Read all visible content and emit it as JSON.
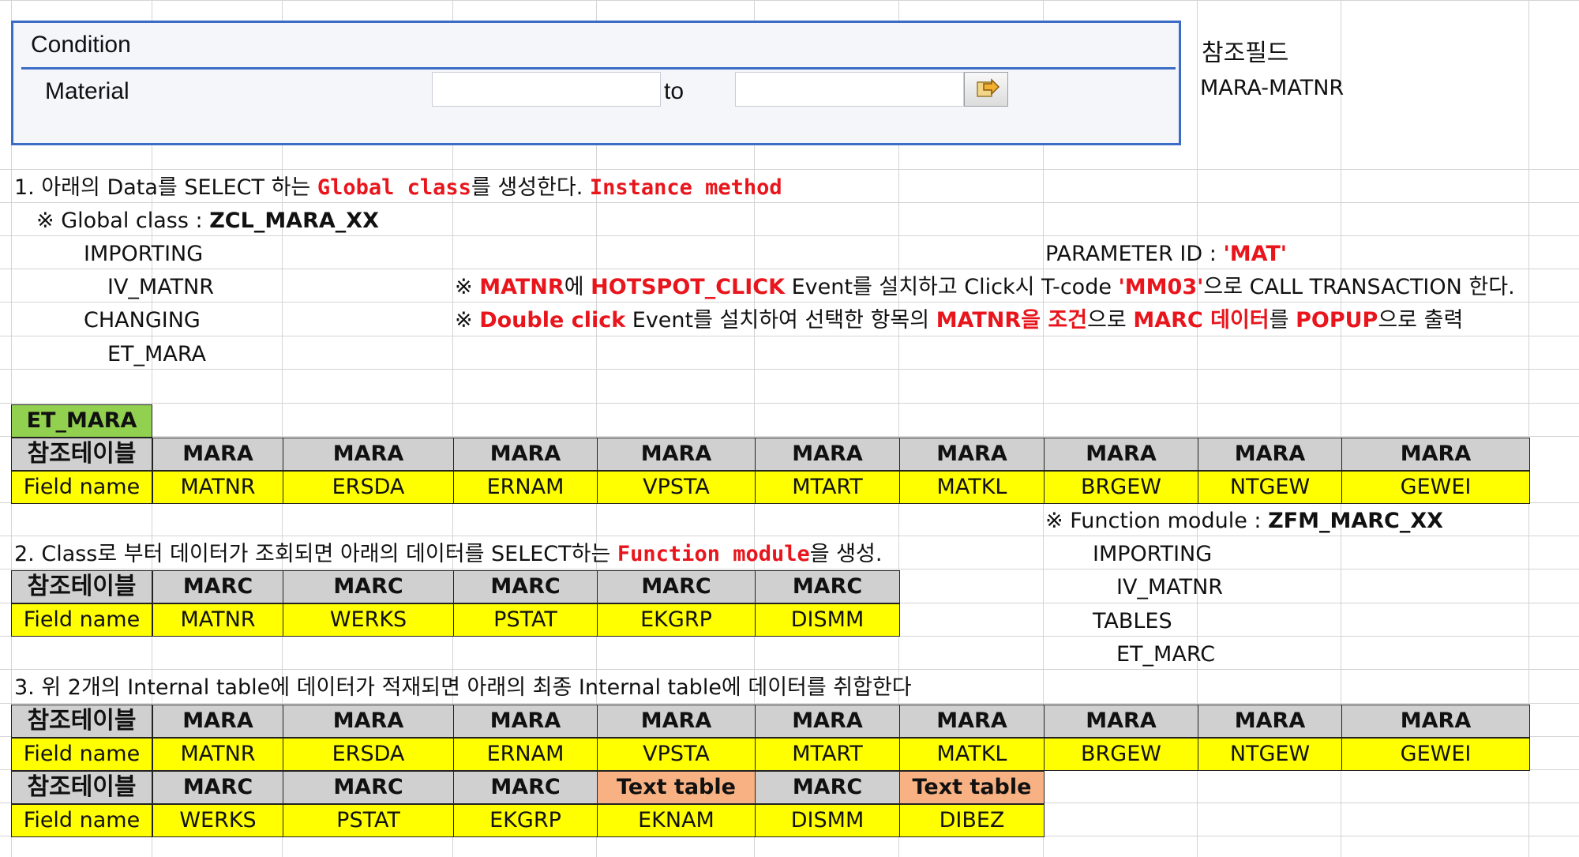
{
  "condition_panel": {
    "title": "Condition",
    "material_label": "Material",
    "material_from": "",
    "to_label": "to",
    "material_to": "",
    "multiple_selection_icon": "arrow-right-icon"
  },
  "ref_field": {
    "label": "참조필드",
    "value": "MARA-MATNR"
  },
  "section1": {
    "num": "1. ",
    "t1": "아래의 Data를 SELECT 하는 ",
    "t2": "Global class",
    "t3": "를 생성한다. ",
    "t4": "Instance method",
    "gc_prefix": "※ Global class  : ",
    "gc_name": "ZCL_MARA_XX",
    "importing": "IMPORTING",
    "iv_matnr": "IV_MATNR",
    "changing": "CHANGING",
    "et_mara": "ET_MARA",
    "param_prefix": "PARAMETER ID : ",
    "param_value": "'MAT'",
    "hs_mark": "※ ",
    "hs1": "MATNR",
    "hs2": "에 ",
    "hs3": "HOTSPOT_CLICK",
    "hs4": " Event를 설치하고 Click시 T-code ",
    "hs5": "'MM03'",
    "hs6": "으로 CALL TRANSACTION 한다.",
    "dc_mark": "※ ",
    "dc1": "Double click",
    "dc2": " Event를 설치하여 선택한 항목의 ",
    "dc3": "MATNR을 조건",
    "dc4": "으로 ",
    "dc5": "MARC 데이터",
    "dc6": "를 ",
    "dc7": "POPUP",
    "dc8": "으로 출력"
  },
  "table1": {
    "title": "ET_MARA",
    "ref_label": "참조테이블",
    "field_label": "Field name",
    "tables": [
      "MARA",
      "MARA",
      "MARA",
      "MARA",
      "MARA",
      "MARA",
      "MARA",
      "MARA",
      "MARA"
    ],
    "fields": [
      "MATNR",
      "ERSDA",
      "ERNAM",
      "VPSTA",
      "MTART",
      "MATKL",
      "BRGEW",
      "NTGEW",
      "GEWEI"
    ]
  },
  "section2": {
    "text_a": "2. Class로 부터 데이터가 조회되면 아래의 데이터를 SELECT하는 ",
    "text_b": "Function module",
    "text_c": "을 생성.",
    "fm_prefix": "※ Function module  : ",
    "fm_name": "ZFM_MARC_XX",
    "importing": "IMPORTING",
    "iv_matnr": "IV_MATNR",
    "tables": "TABLES",
    "et_marc": "ET_MARC"
  },
  "table2": {
    "ref_label": "참조테이블",
    "field_label": "Field name",
    "tables": [
      "MARC",
      "MARC",
      "MARC",
      "MARC",
      "MARC"
    ],
    "fields": [
      "MATNR",
      "WERKS",
      "PSTAT",
      "EKGRP",
      "DISMM"
    ]
  },
  "section3": {
    "text": "3. 위 2개의 Internal table에 데이터가 적재되면 아래의 최종 Internal table에 데이터를 취합한다"
  },
  "table3": {
    "ref_label": "참조테이블",
    "field_label": "Field name",
    "row1_tables": [
      "MARA",
      "MARA",
      "MARA",
      "MARA",
      "MARA",
      "MARA",
      "MARA",
      "MARA",
      "MARA"
    ],
    "row1_fields": [
      "MATNR",
      "ERSDA",
      "ERNAM",
      "VPSTA",
      "MTART",
      "MATKL",
      "BRGEW",
      "NTGEW",
      "GEWEI"
    ],
    "row2_tables": [
      "MARC",
      "MARC",
      "MARC",
      "Text table",
      "MARC",
      "Text table"
    ],
    "row2_fields": [
      "WERKS",
      "PSTAT",
      "EKGRP",
      "EKNAM",
      "DISMM",
      "DIBEZ"
    ]
  },
  "colors": {
    "panel_border": "#3b6cc6",
    "header_gray": "#d0d0d0",
    "field_yellow": "#ffff00",
    "text_table_orange": "#f7b183",
    "title_green": "#92d050",
    "highlight_red": "#e8161c"
  }
}
